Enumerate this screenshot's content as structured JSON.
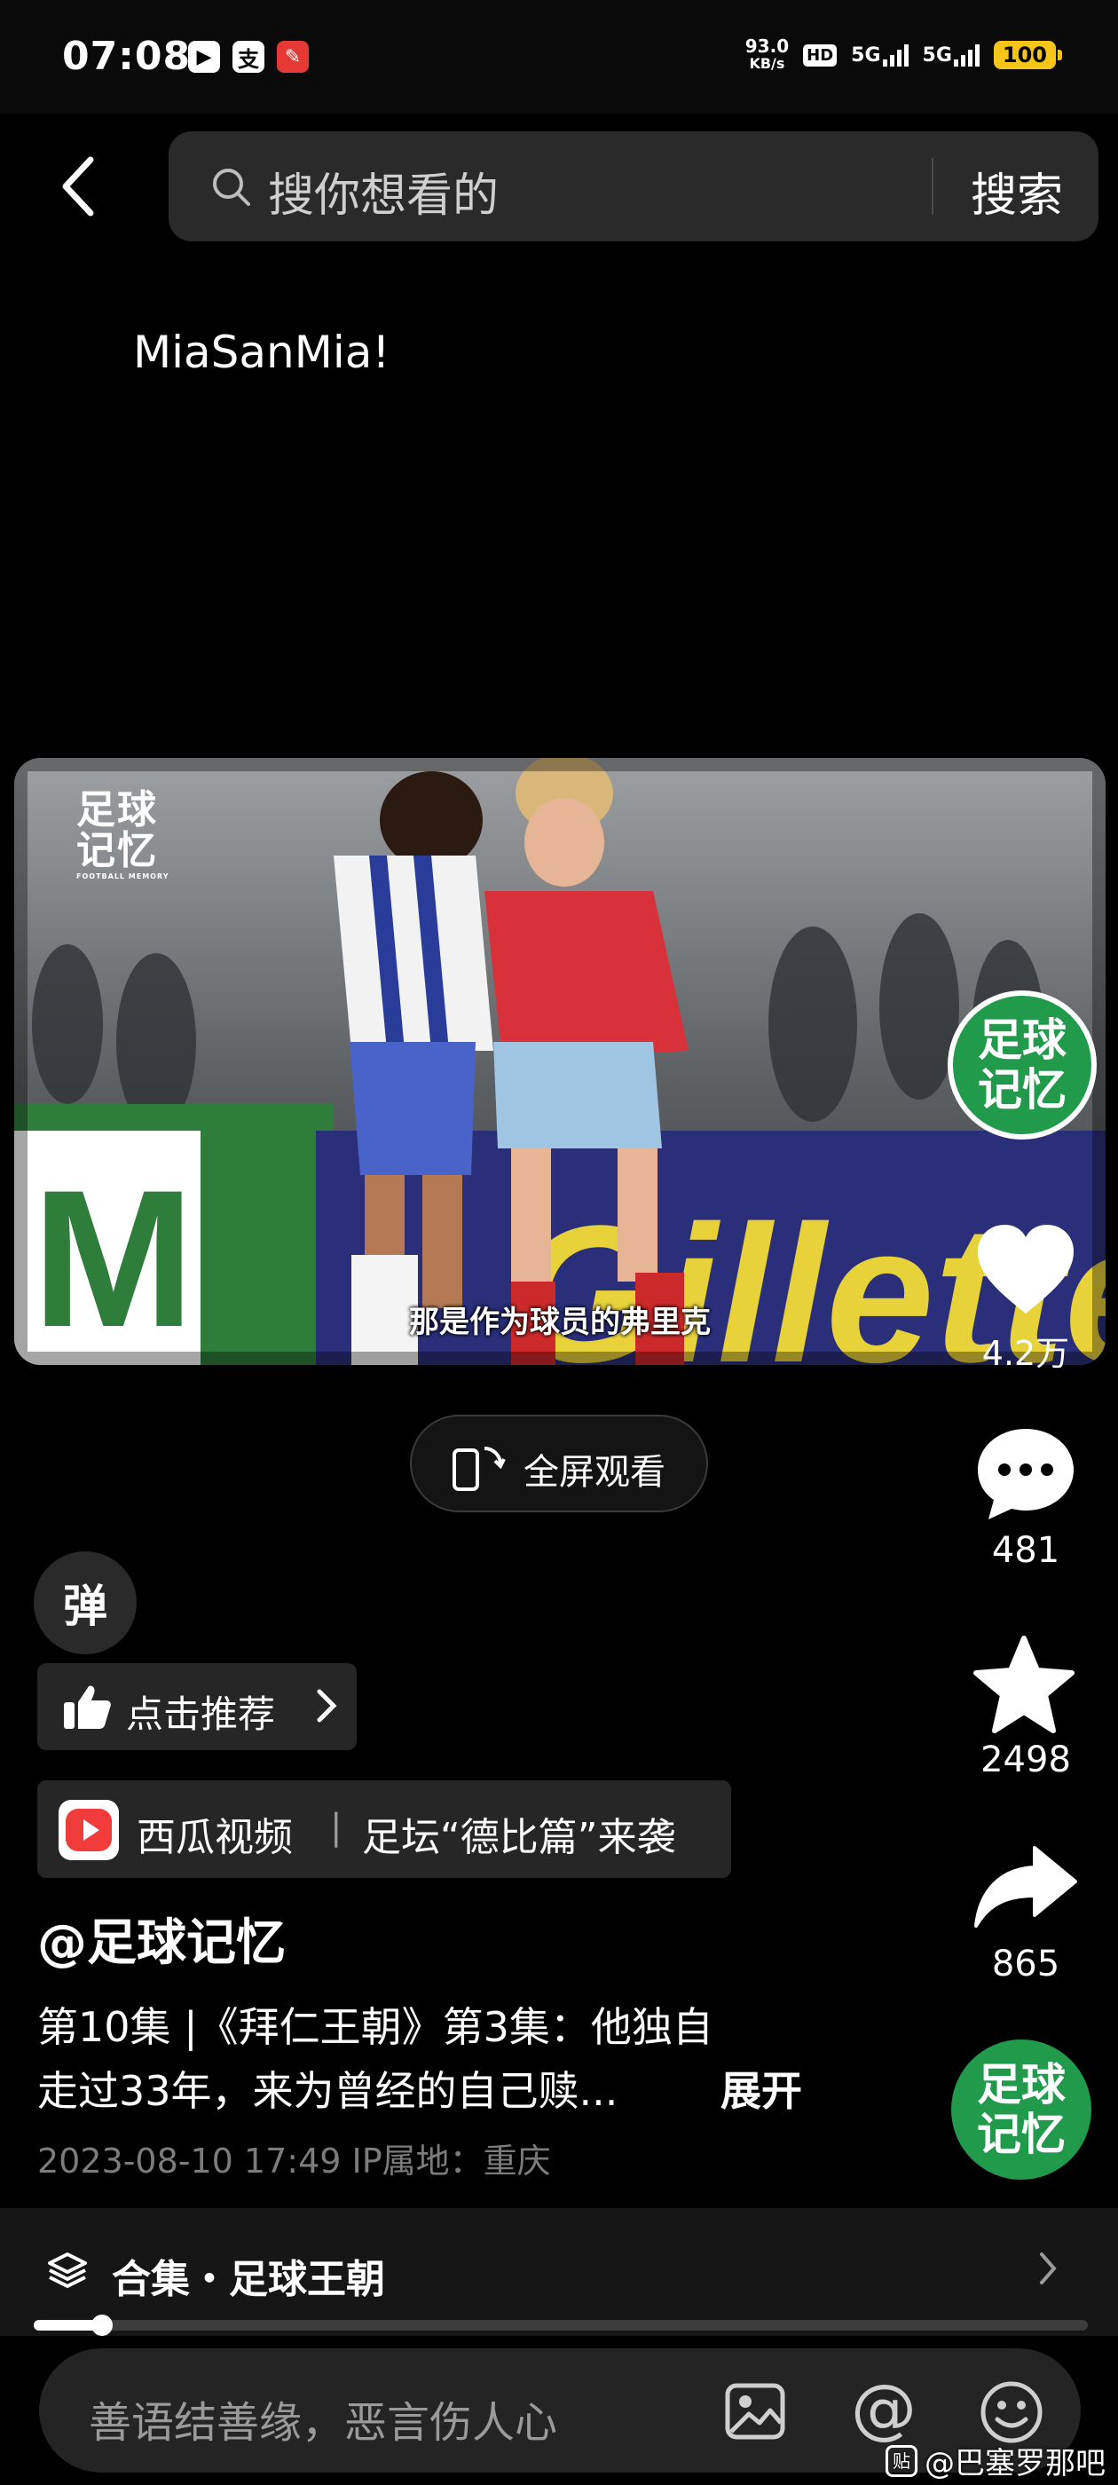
{
  "status_bar": {
    "time": "07:08",
    "app_icons": [
      "play-icon",
      "zhi-icon",
      "news-icon"
    ],
    "net_speed": "93.0",
    "net_unit": "KB/s",
    "hd": "HD",
    "sim1": "5G",
    "sim2": "5G",
    "battery": "100"
  },
  "search": {
    "placeholder": "搜你想看的",
    "button_label": "搜索"
  },
  "post": {
    "text": "MiaSanMia!"
  },
  "video": {
    "watermark": "足球记忆",
    "watermark_sub": "FOOTBALL MEMORY",
    "subtitle": "那是作为球员的弗里克",
    "fullscreen_label": "全屏观看"
  },
  "actions": {
    "avatar_text": "足球记忆",
    "likes": "4.2万",
    "comments": "481",
    "favorites": "2498",
    "shares": "865"
  },
  "danmaku": {
    "label": "弹"
  },
  "recommend": {
    "label": "点击推荐"
  },
  "xigua": {
    "app": "西瓜视频",
    "separator": "|",
    "topic": "足坛“德比篇”来袭"
  },
  "author": {
    "name": "@足球记忆"
  },
  "description": {
    "line1": "第10集 |《拜仁王朝》第3集：他独自",
    "line2": "走过33年，来为曾经的自己赎...",
    "expand": "展开"
  },
  "meta": {
    "date_location": "2023-08-10 17:49  IP属地：重庆"
  },
  "collection": {
    "label": "合集・足球王朝"
  },
  "playback": {
    "progress": 0.065
  },
  "comment_bar": {
    "placeholder": "善语结善缘，恶言伤人心",
    "at_symbol": "@"
  },
  "watermark": {
    "tieba": "@巴塞罗那吧",
    "tieba_icon": "贴"
  },
  "colors": {
    "background": "#000000",
    "avatar_green": "#219a4b",
    "battery": "#f5c518"
  }
}
